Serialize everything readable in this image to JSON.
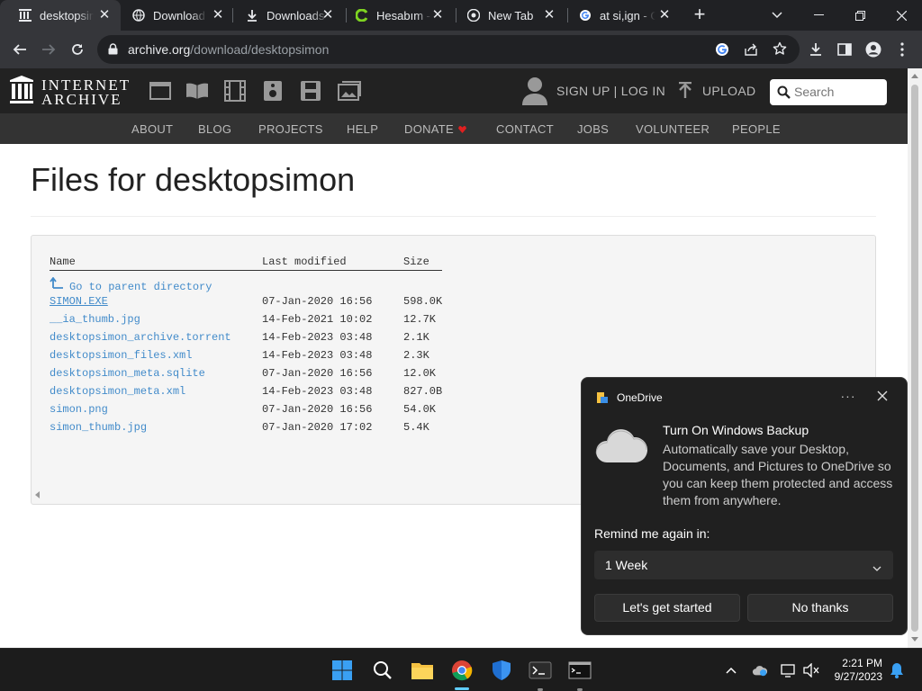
{
  "browser": {
    "tabs": [
      {
        "label": "desktopsimon",
        "active": true,
        "icon": "internet-archive-icon"
      },
      {
        "label": "Download Disk",
        "active": false,
        "icon": "globe-icon"
      },
      {
        "label": "Downloads",
        "active": false,
        "icon": "download-icon"
      },
      {
        "label": "Hesabım - Ecu",
        "active": false,
        "icon": "green-app-icon"
      },
      {
        "label": "New Tab",
        "active": false,
        "icon": "chrome-icon"
      },
      {
        "label": "at si,ign - Google",
        "active": false,
        "icon": "google-icon"
      }
    ],
    "url_domain": "archive.org",
    "url_path": "/download/desktopsimon"
  },
  "ia_header": {
    "logo_line1": "INTERNET",
    "logo_line2": "ARCHIVE",
    "signup_login": "SIGN UP | LOG IN",
    "upload": "UPLOAD",
    "search_placeholder": "Search",
    "nav": [
      "ABOUT",
      "BLOG",
      "PROJECTS",
      "HELP",
      "DONATE",
      "CONTACT",
      "JOBS",
      "VOLUNTEER",
      "PEOPLE"
    ]
  },
  "page": {
    "title": "Files for desktopsimon",
    "columns": {
      "name": "Name",
      "modified": "Last modified",
      "size": "Size"
    },
    "parent_link": "Go to parent directory",
    "files": [
      {
        "name": "SIMON.EXE",
        "modified": "07-Jan-2020 16:56",
        "size": "598.0K"
      },
      {
        "name": "__ia_thumb.jpg",
        "modified": "14-Feb-2021 10:02",
        "size": "12.7K"
      },
      {
        "name": "desktopsimon_archive.torrent",
        "modified": "14-Feb-2023 03:48",
        "size": "2.1K"
      },
      {
        "name": "desktopsimon_files.xml",
        "modified": "14-Feb-2023 03:48",
        "size": "2.3K"
      },
      {
        "name": "desktopsimon_meta.sqlite",
        "modified": "07-Jan-2020 16:56",
        "size": "12.0K"
      },
      {
        "name": "desktopsimon_meta.xml",
        "modified": "14-Feb-2023 03:48",
        "size": "827.0B"
      },
      {
        "name": "simon.png",
        "modified": "07-Jan-2020 16:56",
        "size": "54.0K"
      },
      {
        "name": "simon_thumb.jpg",
        "modified": "07-Jan-2020 17:02",
        "size": "5.4K"
      }
    ]
  },
  "onedrive": {
    "app_name": "OneDrive",
    "more": "···",
    "title": "Turn On Windows Backup",
    "body": "Automatically save your Desktop, Documents, and Pictures to OneDrive so you can keep them protected and access them from anywhere.",
    "remind_label": "Remind me again in:",
    "remind_value": "1 Week",
    "primary_button": "Let's get started",
    "secondary_button": "No thanks"
  },
  "taskbar": {
    "time": "2:21 PM",
    "date": "9/27/2023"
  },
  "colors": {
    "link": "#428bca",
    "ia_dark": "#222222",
    "accent": "#60cdff"
  }
}
